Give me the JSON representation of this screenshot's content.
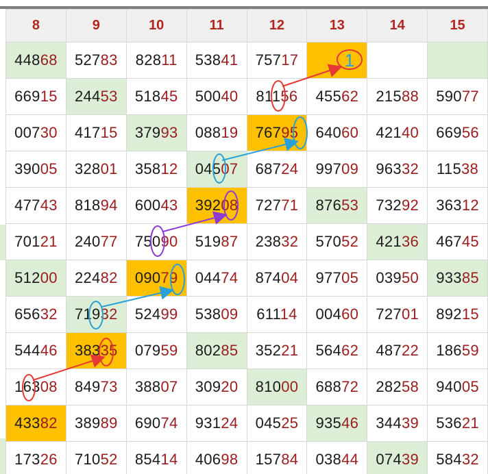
{
  "header": {
    "columns": [
      "8",
      "9",
      "10",
      "11",
      "12",
      "13",
      "14",
      "15"
    ]
  },
  "grid": {
    "rows": [
      [
        [
          "448",
          "68",
          "green"
        ],
        [
          "527",
          "83",
          "white"
        ],
        [
          "828",
          "11",
          "white"
        ],
        [
          "538",
          "41",
          "white"
        ],
        [
          "757",
          "17",
          "white"
        ],
        [
          "",
          "",
          "orange"
        ],
        [
          "",
          "",
          "white"
        ],
        [
          "",
          "",
          "green"
        ]
      ],
      [
        [
          "669",
          "15",
          "white"
        ],
        [
          "244",
          "53",
          "green"
        ],
        [
          "518",
          "45",
          "white"
        ],
        [
          "500",
          "40",
          "white"
        ],
        [
          "811",
          "56",
          "white"
        ],
        [
          "455",
          "62",
          "white"
        ],
        [
          "215",
          "88",
          "white"
        ],
        [
          "590",
          "77",
          "white"
        ]
      ],
      [
        [
          "007",
          "30",
          "white"
        ],
        [
          "417",
          "15",
          "white"
        ],
        [
          "379",
          "93",
          "green"
        ],
        [
          "088",
          "19",
          "white"
        ],
        [
          "767",
          "95",
          "orange"
        ],
        [
          "640",
          "60",
          "white"
        ],
        [
          "421",
          "40",
          "white"
        ],
        [
          "669",
          "56",
          "white"
        ]
      ],
      [
        [
          "390",
          "05",
          "white"
        ],
        [
          "328",
          "01",
          "white"
        ],
        [
          "358",
          "12",
          "white"
        ],
        [
          "045",
          "07",
          "green"
        ],
        [
          "687",
          "24",
          "white"
        ],
        [
          "997",
          "09",
          "white"
        ],
        [
          "963",
          "32",
          "white"
        ],
        [
          "115",
          "38",
          "white"
        ]
      ],
      [
        [
          "477",
          "43",
          "white"
        ],
        [
          "818",
          "94",
          "white"
        ],
        [
          "600",
          "43",
          "white"
        ],
        [
          "392",
          "08",
          "orange"
        ],
        [
          "727",
          "71",
          "white"
        ],
        [
          "876",
          "53",
          "green"
        ],
        [
          "732",
          "92",
          "white"
        ],
        [
          "363",
          "12",
          "white"
        ]
      ],
      [
        [
          "701",
          "21",
          "white"
        ],
        [
          "240",
          "77",
          "white"
        ],
        [
          "750",
          "90",
          "white"
        ],
        [
          "519",
          "87",
          "white"
        ],
        [
          "238",
          "32",
          "white"
        ],
        [
          "570",
          "52",
          "white"
        ],
        [
          "421",
          "36",
          "green"
        ],
        [
          "467",
          "45",
          "white"
        ]
      ],
      [
        [
          "512",
          "00",
          "green"
        ],
        [
          "224",
          "82",
          "white"
        ],
        [
          "090",
          "79",
          "orange"
        ],
        [
          "044",
          "74",
          "white"
        ],
        [
          "874",
          "04",
          "white"
        ],
        [
          "977",
          "05",
          "white"
        ],
        [
          "039",
          "50",
          "white"
        ],
        [
          "933",
          "85",
          "green"
        ]
      ],
      [
        [
          "656",
          "32",
          "white"
        ],
        [
          "719",
          "32",
          "green"
        ],
        [
          "524",
          "99",
          "white"
        ],
        [
          "538",
          "09",
          "white"
        ],
        [
          "611",
          "14",
          "white"
        ],
        [
          "004",
          "60",
          "white"
        ],
        [
          "727",
          "01",
          "white"
        ],
        [
          "892",
          "15",
          "white"
        ]
      ],
      [
        [
          "544",
          "46",
          "white"
        ],
        [
          "383",
          "35",
          "orange"
        ],
        [
          "079",
          "59",
          "white"
        ],
        [
          "802",
          "85",
          "green"
        ],
        [
          "352",
          "21",
          "white"
        ],
        [
          "564",
          "62",
          "white"
        ],
        [
          "487",
          "22",
          "white"
        ],
        [
          "186",
          "59",
          "white"
        ]
      ],
      [
        [
          "163",
          "08",
          "white"
        ],
        [
          "849",
          "73",
          "white"
        ],
        [
          "388",
          "07",
          "white"
        ],
        [
          "309",
          "20",
          "white"
        ],
        [
          "810",
          "00",
          "green"
        ],
        [
          "688",
          "72",
          "white"
        ],
        [
          "282",
          "58",
          "white"
        ],
        [
          "940",
          "05",
          "white"
        ]
      ],
      [
        [
          "433",
          "82",
          "orange"
        ],
        [
          "389",
          "89",
          "white"
        ],
        [
          "690",
          "74",
          "white"
        ],
        [
          "931",
          "24",
          "white"
        ],
        [
          "045",
          "25",
          "white"
        ],
        [
          "935",
          "46",
          "green"
        ],
        [
          "344",
          "39",
          "white"
        ],
        [
          "536",
          "21",
          "white"
        ]
      ],
      [
        [
          "173",
          "26",
          "white"
        ],
        [
          "710",
          "52",
          "white"
        ],
        [
          "854",
          "14",
          "white"
        ],
        [
          "406",
          "98",
          "white"
        ],
        [
          "157",
          "84",
          "white"
        ],
        [
          "038",
          "44",
          "white"
        ],
        [
          "074",
          "39",
          "green"
        ],
        [
          "584",
          "32",
          "white"
        ]
      ]
    ]
  },
  "annotation": {
    "marker_text": "1",
    "colors": {
      "red": "#e53935",
      "blue": "#2aa0d8",
      "purple": "#8e3bd6"
    }
  }
}
